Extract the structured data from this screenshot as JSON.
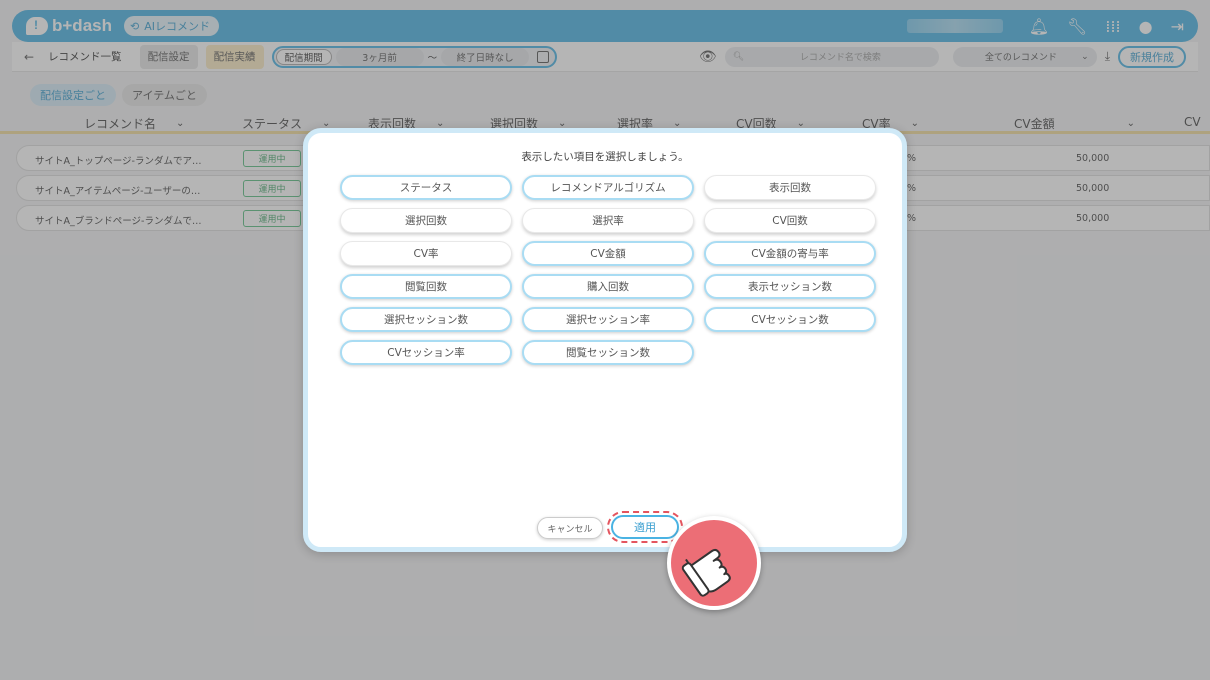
{
  "app": {
    "logo": "b+dash",
    "product": "AIレコメンド"
  },
  "subnav": {
    "back": "←",
    "list": "レコメンド一覧",
    "tab_settings": "配信設定",
    "tab_results": "配信実績",
    "period_label": "配信期間",
    "period_start": "3ヶ月前",
    "period_sep": "〜",
    "period_end": "終了日時なし",
    "search_placeholder": "レコメンド名で検索",
    "filter_select": "全てのレコメンド",
    "new_button": "新規作成"
  },
  "filters": [
    "配信設定ごと",
    "アイテムごと"
  ],
  "table": {
    "headers": [
      "レコメンド名",
      "ステータス",
      "表示回数",
      "選択回数",
      "選択率",
      "CV回数",
      "CV率",
      "CV金額",
      "CV"
    ],
    "rows": [
      {
        "name": "サイトA_トップページ-ランダムでア…",
        "status": "運用中",
        "rate_suffix": "%",
        "amount": "50,000"
      },
      {
        "name": "サイトA_アイテムページ-ユーザーの…",
        "status": "運用中",
        "rate_suffix": "%",
        "amount": "50,000"
      },
      {
        "name": "サイトA_ブランドページ-ランダムで…",
        "status": "運用中",
        "rate_suffix": "%",
        "amount": "50,000"
      }
    ]
  },
  "modal": {
    "title": "表示したい項目を選択しましょう。",
    "options": [
      {
        "label": "ステータス",
        "selected": true
      },
      {
        "label": "レコメンドアルゴリズム",
        "selected": true
      },
      {
        "label": "表示回数",
        "selected": false
      },
      {
        "label": "選択回数",
        "selected": false
      },
      {
        "label": "選択率",
        "selected": false
      },
      {
        "label": "CV回数",
        "selected": false
      },
      {
        "label": "CV率",
        "selected": false
      },
      {
        "label": "CV金額",
        "selected": true
      },
      {
        "label": "CV金額の寄与率",
        "selected": true
      },
      {
        "label": "閲覧回数",
        "selected": true
      },
      {
        "label": "購入回数",
        "selected": true
      },
      {
        "label": "表示セッション数",
        "selected": true
      },
      {
        "label": "選択セッション数",
        "selected": true
      },
      {
        "label": "選択セッション率",
        "selected": true
      },
      {
        "label": "CVセッション数",
        "selected": true
      },
      {
        "label": "CVセッション率",
        "selected": true
      },
      {
        "label": "閲覧セッション数",
        "selected": true
      }
    ],
    "cancel": "キャンセル",
    "apply": "適用"
  },
  "colors": {
    "accent": "#4ab3e3",
    "highlight": "#e4545e",
    "status_green": "#5bbf83"
  }
}
